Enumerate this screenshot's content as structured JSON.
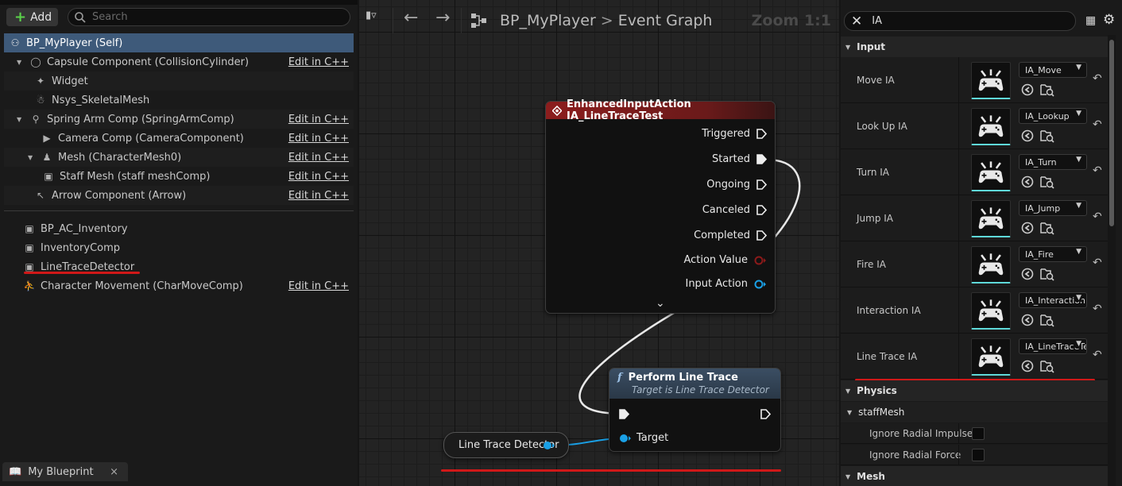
{
  "left_panel": {
    "add_label": "Add",
    "search_placeholder": "Search",
    "components": [
      {
        "name": "BP_MyPlayer (Self)",
        "icon": "person-icon",
        "edit": ""
      },
      {
        "name": "Capsule Component (CollisionCylinder)",
        "icon": "capsule-icon",
        "edit": "Edit in C++"
      },
      {
        "name": "Widget",
        "icon": "widget-icon",
        "edit": ""
      },
      {
        "name": "Nsys_SkeletalMesh",
        "icon": "skeletal-mesh-icon",
        "edit": ""
      },
      {
        "name": "Spring Arm Comp (SpringArmComp)",
        "icon": "spring-arm-icon",
        "edit": "Edit in C++"
      },
      {
        "name": "Camera Comp (CameraComponent)",
        "icon": "camera-icon",
        "edit": "Edit in C++"
      },
      {
        "name": "Mesh (CharacterMesh0)",
        "icon": "character-mesh-icon",
        "edit": "Edit in C++"
      },
      {
        "name": "Staff Mesh (staff meshComp)",
        "icon": "static-mesh-icon",
        "edit": "Edit in C++"
      },
      {
        "name": "Arrow Component (Arrow)",
        "icon": "arrow-icon",
        "edit": "Edit in C++"
      },
      {
        "name": "BP_AC_Inventory",
        "icon": "actor-component-icon",
        "edit": ""
      },
      {
        "name": "InventoryComp",
        "icon": "actor-component-icon",
        "edit": ""
      },
      {
        "name": "LineTraceDetector",
        "icon": "actor-component-icon",
        "edit": ""
      },
      {
        "name": "Character Movement (CharMoveComp)",
        "icon": "movement-icon",
        "edit": "Edit in C++"
      }
    ],
    "bottom_tab": "My Blueprint",
    "bottom_tab_close": "×"
  },
  "graph": {
    "breadcrumb_root": "BP_MyPlayer",
    "breadcrumb_sep": ">",
    "breadcrumb_leaf": "Event Graph",
    "zoom": "Zoom 1:1",
    "event_node": {
      "title": "EnhancedInputAction IA_LineTraceTest",
      "pins": [
        "Triggered",
        "Started",
        "Ongoing",
        "Canceled",
        "Completed"
      ],
      "action_value": "Action Value",
      "input_action": "Input Action"
    },
    "function_node": {
      "title": "Perform Line Trace",
      "subtitle": "Target is Line Trace Detector",
      "target_label": "Target"
    },
    "variable_node": {
      "label": "Line Trace Detector"
    },
    "colors": {
      "exec": "#ffffff",
      "action_value": "#8b1a1a",
      "object": "#1aa0e6",
      "accent": "#d01818"
    }
  },
  "details": {
    "search_value": "IA",
    "categories": {
      "input": "Input",
      "physics": "Physics",
      "staff_mesh": "staffMesh",
      "mesh": "Mesh"
    },
    "input_rows": [
      {
        "label": "Move IA",
        "value": "IA_Move"
      },
      {
        "label": "Look Up IA",
        "value": "IA_Lookup"
      },
      {
        "label": "Turn IA",
        "value": "IA_Turn"
      },
      {
        "label": "Jump IA",
        "value": "IA_Jump"
      },
      {
        "label": "Fire IA",
        "value": "IA_Fire"
      },
      {
        "label": "Interaction IA",
        "value": "IA_Interaction"
      },
      {
        "label": "Line Trace IA",
        "value": "IA_LineTraceTest"
      }
    ],
    "checkbox_rows": [
      {
        "label": "Ignore Radial Impulse"
      },
      {
        "label": "Ignore Radial Force"
      }
    ]
  }
}
